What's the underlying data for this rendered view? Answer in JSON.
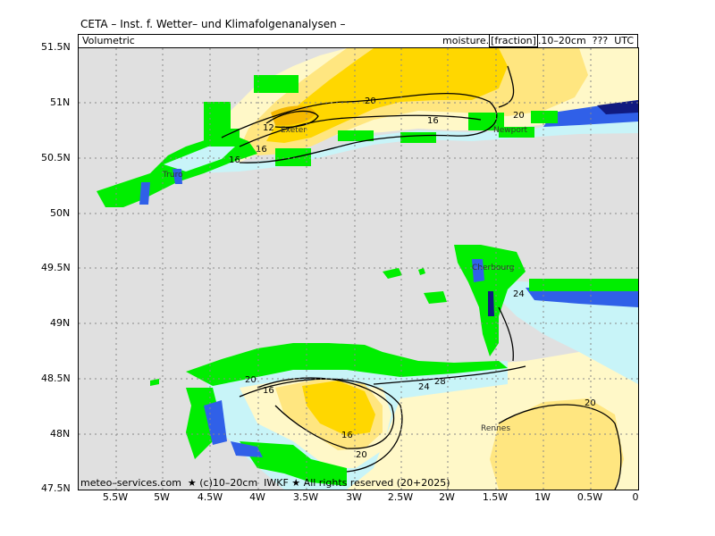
{
  "header": {
    "title": "CETA – Inst. f. Wetter– und Klimafolgenanalysen –",
    "subtitle_left": "Volumetric",
    "subtitle_right_prefix": "moisture.",
    "subtitle_right_boxed": "[fraction]",
    "subtitle_right_suffix": ".10–20cm  ???  UTC"
  },
  "credit": "meteo–services.com  ★ (c)10–20cm  IWKF ★ All rights reserved (20+2025)",
  "axes": {
    "y_ticks": [
      "51.5N",
      "51N",
      "50.5N",
      "50N",
      "49.5N",
      "49N",
      "48.5N",
      "48N",
      "47.5N"
    ],
    "x_ticks": [
      "5.5W",
      "5W",
      "4.5W",
      "4W",
      "3.5W",
      "3W",
      "2.5W",
      "2W",
      "1.5W",
      "1W",
      "0.5W",
      "0"
    ]
  },
  "contour_labels": [
    "12",
    "16",
    "20",
    "16",
    "20",
    "16",
    "20",
    "24",
    "28",
    "24",
    "20",
    "16",
    "16",
    "20",
    "20",
    "24",
    "20"
  ],
  "city_labels": [
    "Exeter",
    "Newport",
    "Truro",
    "Rennes",
    "Cherbourg"
  ],
  "colors": {
    "sea": "#e0e0e0",
    "land_green": "#00ee00",
    "cyan": "#c8f4f8",
    "light_yellow": "#fff8c8",
    "yellow": "#ffe680",
    "orange": "#ffd700",
    "dark_orange": "#f5b800",
    "blue": "#3060e8",
    "dark_blue": "#101a80"
  }
}
